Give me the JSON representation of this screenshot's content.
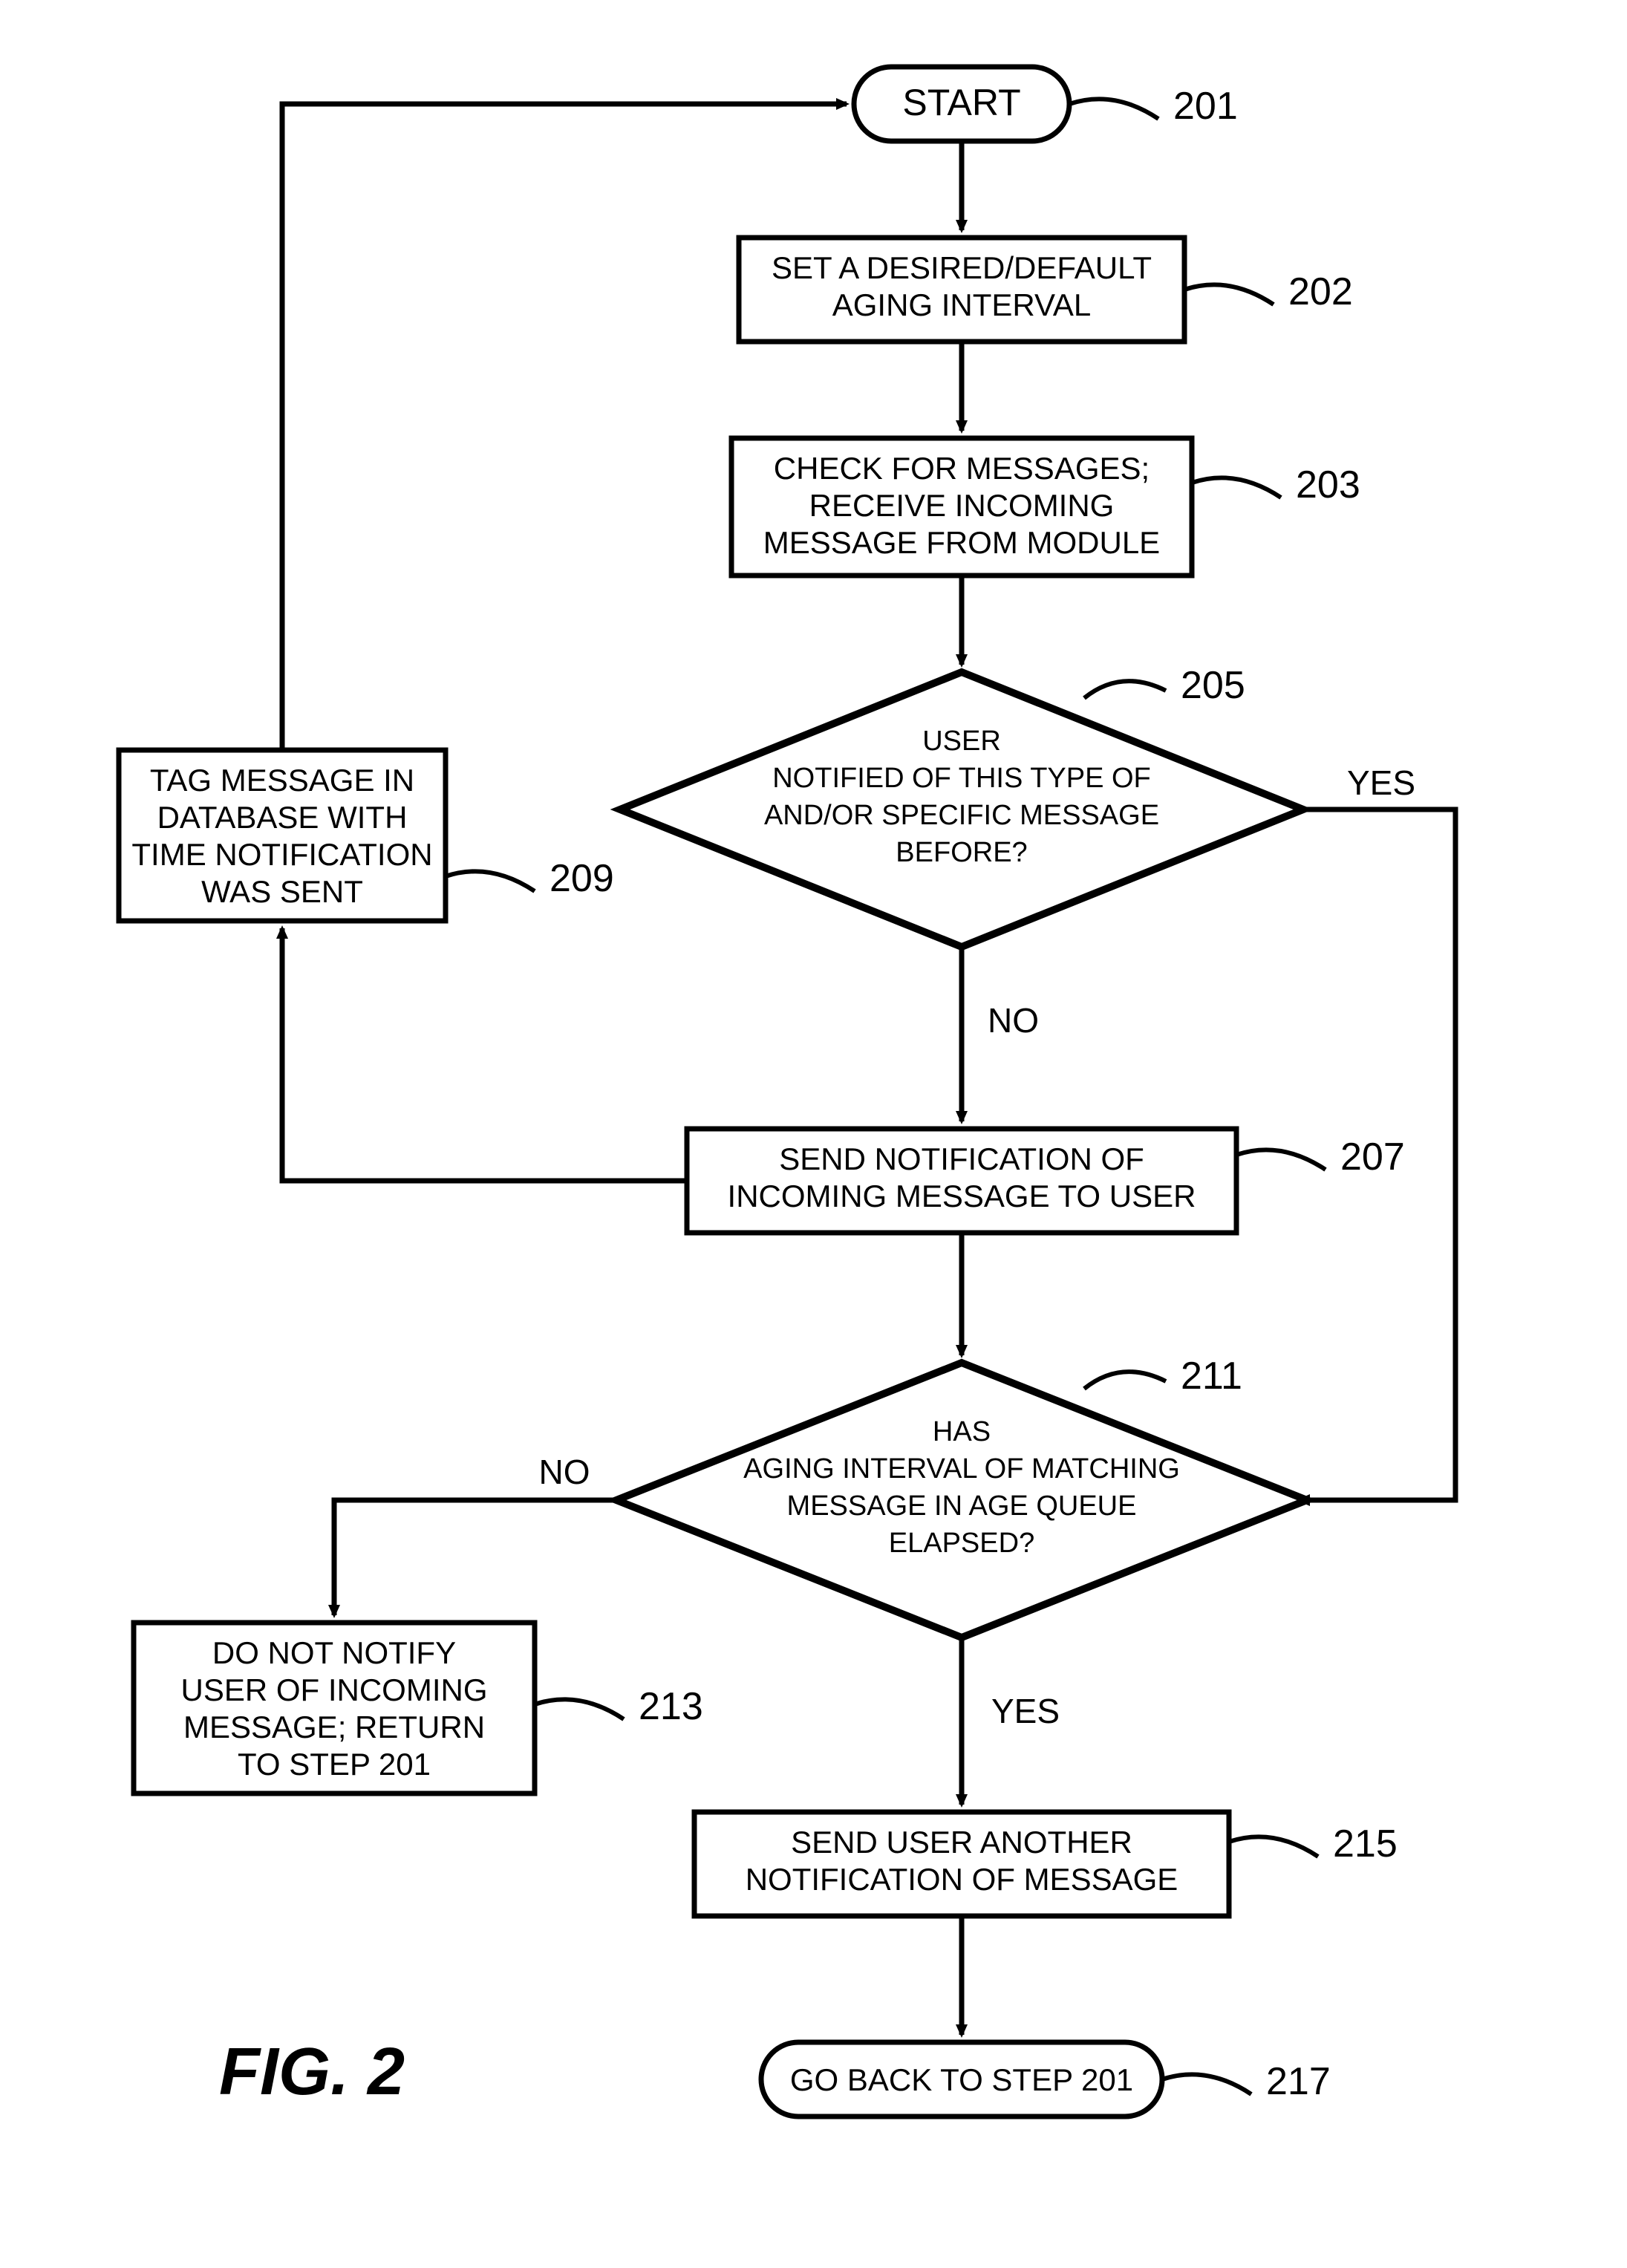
{
  "flowchart": {
    "title": "FIG. 2",
    "nodes": {
      "n201": {
        "ref": "201",
        "kind": "terminator",
        "text": "START"
      },
      "n202": {
        "ref": "202",
        "kind": "process",
        "lines": [
          "SET A DESIRED/DEFAULT",
          "AGING INTERVAL"
        ]
      },
      "n203": {
        "ref": "203",
        "kind": "process",
        "lines": [
          "CHECK FOR MESSAGES;",
          "RECEIVE INCOMING",
          "MESSAGE FROM MODULE"
        ]
      },
      "n205": {
        "ref": "205",
        "kind": "decision",
        "lines": [
          "USER",
          "NOTIFIED OF THIS TYPE OF",
          "AND/OR SPECIFIC MESSAGE",
          "BEFORE?"
        ]
      },
      "n207": {
        "ref": "207",
        "kind": "process",
        "lines": [
          "SEND NOTIFICATION OF",
          "INCOMING MESSAGE TO USER"
        ]
      },
      "n209": {
        "ref": "209",
        "kind": "process",
        "lines": [
          "TAG MESSAGE IN",
          "DATABASE WITH",
          "TIME NOTIFICATION",
          "WAS SENT"
        ]
      },
      "n211": {
        "ref": "211",
        "kind": "decision",
        "lines": [
          "HAS",
          "AGING INTERVAL OF MATCHING",
          "MESSAGE IN AGE QUEUE",
          "ELAPSED?"
        ]
      },
      "n213": {
        "ref": "213",
        "kind": "process",
        "lines": [
          "DO NOT NOTIFY",
          "USER OF INCOMING",
          "MESSAGE; RETURN",
          "TO STEP 201"
        ]
      },
      "n215": {
        "ref": "215",
        "kind": "process",
        "lines": [
          "SEND USER ANOTHER",
          "NOTIFICATION OF MESSAGE"
        ]
      },
      "n217": {
        "ref": "217",
        "kind": "terminator",
        "text": "GO BACK TO STEP 201"
      }
    },
    "edge_labels": {
      "n205_yes": "YES",
      "n205_no": "NO",
      "n211_yes": "YES",
      "n211_no": "NO"
    }
  }
}
